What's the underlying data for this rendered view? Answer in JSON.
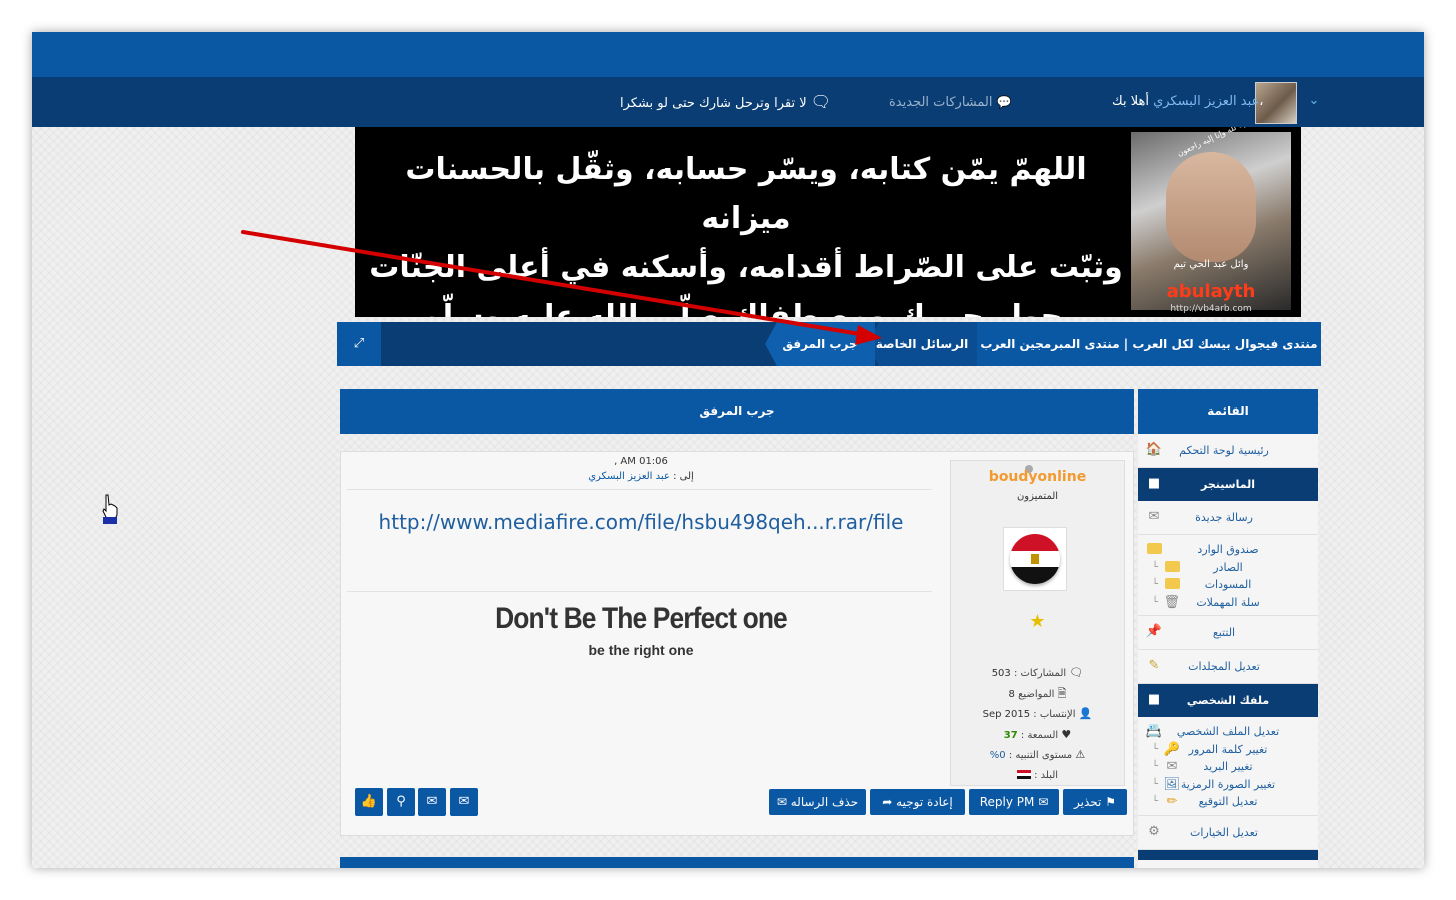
{
  "navbar": {
    "welcome_prefix": "أهلا بك،",
    "username": "عبد العزيز البسكري",
    "new_posts": "المشاركات الجديدة",
    "motto": "لا تقرا وترحل شارك حتى لو بشكرا"
  },
  "banner": {
    "line1": "اللهمّ يمّن كتابه، ويسّر حسابه، وثقّل بالحسنات ميزانه",
    "line2": "وثبّت على الصّراط أقدامه، وأسكنه في أعلى الجنّات",
    "line3": "بجوار حبيبك ومصطفاك صلّى الله عليه وسلّم",
    "photo_caption_top": "إنا لله وإنا إليه راجعون",
    "photo_name": "وائل عبد الحي تيم",
    "photo_brand": "abulayth",
    "photo_url": "http://vb4arb.com"
  },
  "breadcrumb": {
    "forum": "منتدى فيجوال بيسك لكل العرب | منتدى المبرمجين العرب",
    "pm": "الرسائل الخاصة",
    "current": "جرب المرفق"
  },
  "content": {
    "title": "جرب المرفق",
    "date": ", AM 01:06",
    "to_prefix": "إلى :",
    "to_user": "عبد العزيز البسكري",
    "link": "http://www.mediafire.com/file/hsbu498qeh...r.rar/file",
    "signature_title": "Don't Be The Perfect one",
    "signature_sub": "be the right one"
  },
  "author": {
    "name": "boudyonline",
    "rank": "المتميزون",
    "posts_label": "المشاركات :",
    "posts_value": "503",
    "topics_label": "المواضيع",
    "topics_value": "8",
    "joined_label": "الإنتساب :",
    "joined_value": "Sep 2015",
    "reputation_label": "السمعة :",
    "reputation_value": "37",
    "warning_label": "مستوى التنبيه :",
    "warning_value": "0%",
    "country_label": "البلد :"
  },
  "actions": {
    "warn": "تحذير",
    "reply": "Reply PM",
    "forward": "إعادة توجيه",
    "delete": "حذف الرساله"
  },
  "sidebar": {
    "title": "القائمة",
    "cp_home": "رئيسية لوحة التحكم",
    "messenger": "الماسينجر",
    "new_message": "رسالة جديدة",
    "inbox": "صندوق الوارد",
    "sent": "الصادر",
    "drafts": "المسودات",
    "trash": "سلة المهملات",
    "track": "التتبع",
    "edit_folders": "تعديل المجلدات",
    "profile": "ملفك الشخصي",
    "edit_profile": "تعديل الملف الشخصي",
    "change_password": "تغيير كلمة المرور",
    "change_email": "تغيير البريد",
    "change_avatar": "تغيير الصورة الرمزية",
    "edit_signature": "تعديل التوقيع",
    "edit_options": "تعديل الخيارات"
  },
  "colors": {
    "primary": "#0a57a3",
    "dark": "#0a3d73",
    "author_name": "#f29a2e",
    "link": "#1f5fa0",
    "annotation_arrow": "#d40000"
  }
}
